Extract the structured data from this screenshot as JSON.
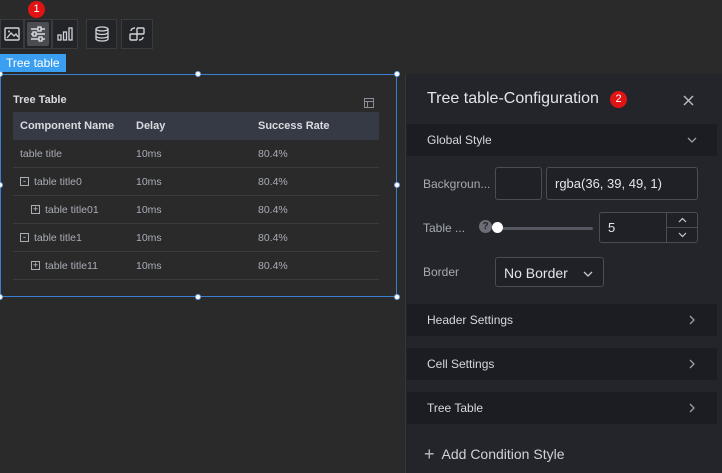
{
  "toolbar": {
    "tools": [
      "image-icon",
      "sliders-icon",
      "bar-chart-icon",
      "database-icon",
      "swap-icon"
    ],
    "badge": "1"
  },
  "widget_label": "Tree table",
  "tree_table": {
    "title": "Tree Table",
    "columns": [
      "Component Name",
      "Delay",
      "Success Rate"
    ],
    "rows": [
      {
        "name": "table title",
        "delay": "10ms",
        "rate": "80.4%",
        "toggle": ""
      },
      {
        "name": "table title0",
        "delay": "10ms",
        "rate": "80.4%",
        "toggle": "-"
      },
      {
        "name": "table title01",
        "delay": "10ms",
        "rate": "80.4%",
        "toggle": "+"
      },
      {
        "name": "table title1",
        "delay": "10ms",
        "rate": "80.4%",
        "toggle": "-"
      },
      {
        "name": "table title11",
        "delay": "10ms",
        "rate": "80.4%",
        "toggle": "+"
      }
    ]
  },
  "panel": {
    "title": "Tree table-Configuration",
    "badge": "2",
    "global_style": {
      "label": "Global Style",
      "background_label": "Backgroun...",
      "background_value": "rgba(36, 39, 49, 1)",
      "table_label": "Table ...",
      "table_value": "5",
      "border_label": "Border",
      "border_value": "No Border"
    },
    "sections": [
      "Header Settings",
      "Cell Settings",
      "Tree Table"
    ],
    "add_condition": "Add Condition Style"
  }
}
